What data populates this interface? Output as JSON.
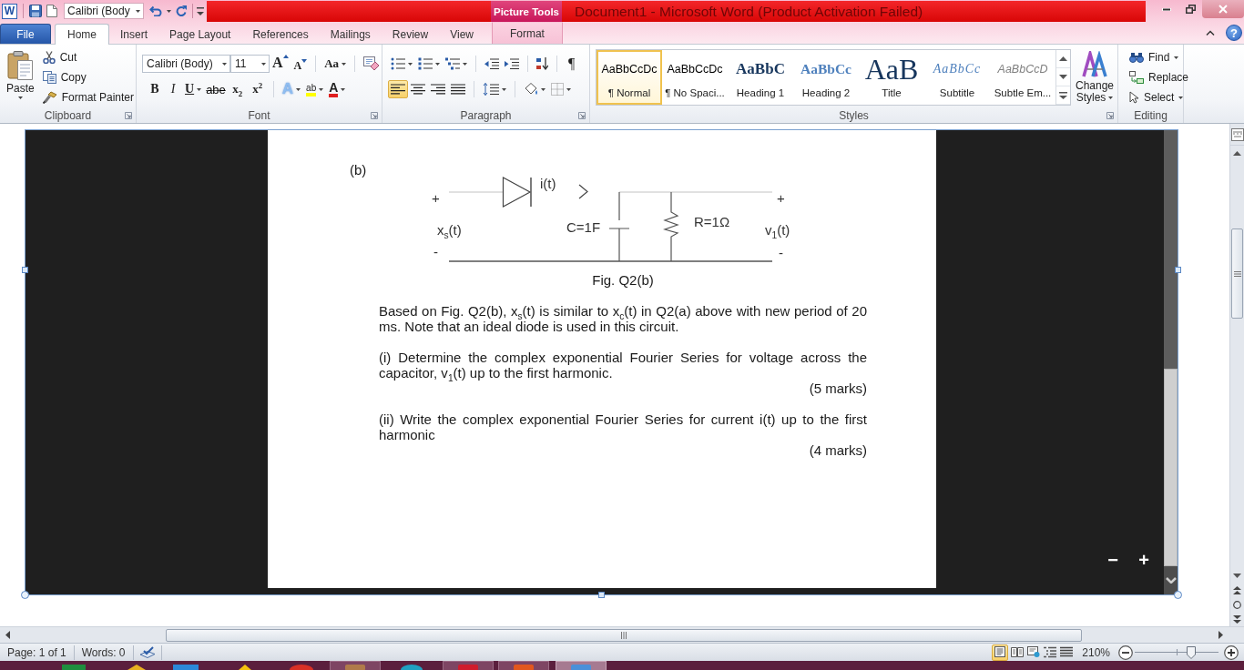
{
  "title_bar": {
    "app_logo": "W",
    "font_box": "Calibri (Body",
    "context_group": "Picture Tools",
    "title": "Document1 - Microsoft Word (Product Activation Failed)"
  },
  "tabs": [
    {
      "label": "File",
      "kind": "file",
      "selected": false
    },
    {
      "label": "Home",
      "kind": "main",
      "selected": true
    },
    {
      "label": "Insert",
      "kind": "main",
      "selected": false
    },
    {
      "label": "Page Layout",
      "kind": "main",
      "selected": false
    },
    {
      "label": "References",
      "kind": "main",
      "selected": false
    },
    {
      "label": "Mailings",
      "kind": "main",
      "selected": false
    },
    {
      "label": "Review",
      "kind": "main",
      "selected": false
    },
    {
      "label": "View",
      "kind": "main",
      "selected": false
    },
    {
      "label": "Format",
      "kind": "contextual",
      "selected": false
    }
  ],
  "help": "?",
  "ribbon": {
    "clipboard": {
      "label": "Clipboard",
      "paste": "Paste",
      "items": [
        {
          "kind": "cut",
          "label": "Cut"
        },
        {
          "kind": "copy",
          "label": "Copy"
        },
        {
          "kind": "format_painter",
          "label": "Format Painter"
        }
      ]
    },
    "font": {
      "label": "Font",
      "name": "Calibri (Body)",
      "size": "11",
      "row1": [
        {
          "kind": "grow",
          "glyph": "A"
        },
        {
          "kind": "shrink",
          "glyph": "A"
        },
        {
          "kind": "case",
          "glyph": "Aa"
        }
      ],
      "row2": [
        {
          "kind": "bold",
          "glyph": "B"
        },
        {
          "kind": "italic",
          "glyph": "I"
        },
        {
          "kind": "underline",
          "glyph": "U"
        },
        {
          "kind": "strike",
          "glyph": "abe"
        },
        {
          "kind": "subscript",
          "glyph": "x$_{2}$"
        },
        {
          "kind": "superscript",
          "glyph": "x$^{2}$"
        },
        {
          "kind": "effects",
          "glyph": "A"
        },
        {
          "kind": "highlight",
          "glyph": "ab"
        },
        {
          "kind": "color",
          "glyph": "A"
        }
      ]
    },
    "paragraph": {
      "label": "Paragraph",
      "pilcrow": "¶",
      "align": [
        {
          "kind": "left",
          "selected": true
        },
        {
          "kind": "center",
          "selected": false
        },
        {
          "kind": "right",
          "selected": false
        },
        {
          "kind": "justify",
          "selected": false
        }
      ]
    },
    "styles": {
      "label": "Styles",
      "items": [
        {
          "kind": "normal",
          "preview": "AaBbCcDc",
          "name": "¶ Normal",
          "selected": true
        },
        {
          "kind": "no_spacing",
          "preview": "AaBbCcDc",
          "name": "¶ No Spaci...",
          "selected": false
        },
        {
          "kind": "heading1",
          "preview": "AaBbC",
          "name": "Heading 1",
          "selected": false
        },
        {
          "kind": "heading2",
          "preview": "AaBbCc",
          "name": "Heading 2",
          "selected": false
        },
        {
          "kind": "title",
          "preview": "AaB",
          "name": "Title",
          "selected": false
        },
        {
          "kind": "subtitle",
          "preview": "AaBbCc",
          "name": "Subtitle",
          "selected": false
        },
        {
          "kind": "subtle_emphasis",
          "preview": "AaBbCcD",
          "name": "Subtle Em...",
          "selected": false
        }
      ],
      "change_styles": "Change Styles"
    },
    "editing": {
      "label": "Editing",
      "items": [
        {
          "kind": "find",
          "label": "Find"
        },
        {
          "kind": "replace",
          "label": "Replace"
        },
        {
          "kind": "select",
          "label": "Select"
        }
      ]
    }
  },
  "document": {
    "viewer_zoom": [
      "−",
      "+"
    ],
    "page": {
      "heading": "(b)",
      "circuit_labels": [
        "+",
        "x$_{s}$(t)",
        "-",
        "i(t)",
        "C=1F",
        "R=1Ω",
        "+",
        "v$_{1}$(t)",
        "-"
      ],
      "caption": "Fig. Q2(b)",
      "blocks": [
        {
          "kind": "paragraph",
          "text": "Based on Fig. Q2(b), x$_{s}$(t) is similar to x$_{c}$(t) in Q2(a) above with new period of 20 ms. Note that an ideal diode is used in this circuit."
        },
        {
          "kind": "paragraph",
          "text": "(i) Determine the complex exponential Fourier Series for voltage across the capacitor, v$_{1}$(t) up to the first harmonic."
        },
        {
          "kind": "marks",
          "text": "(5 marks)"
        },
        {
          "kind": "paragraph",
          "text": "(ii) Write the complex exponential Fourier Series for current i(t) up to the first harmonic"
        },
        {
          "kind": "marks",
          "text": "(4 marks)"
        }
      ]
    }
  },
  "status_bar": {
    "page": "Page: 1 of 1",
    "words": "Words: 0",
    "views": [
      {
        "kind": "print_layout",
        "selected": true
      },
      {
        "kind": "full_screen_reading",
        "selected": false
      },
      {
        "kind": "web_layout",
        "selected": false
      },
      {
        "kind": "outline",
        "selected": false
      },
      {
        "kind": "draft",
        "selected": false
      }
    ],
    "zoom": "210%",
    "zoom_slider": {
      "level": 0.67
    }
  }
}
